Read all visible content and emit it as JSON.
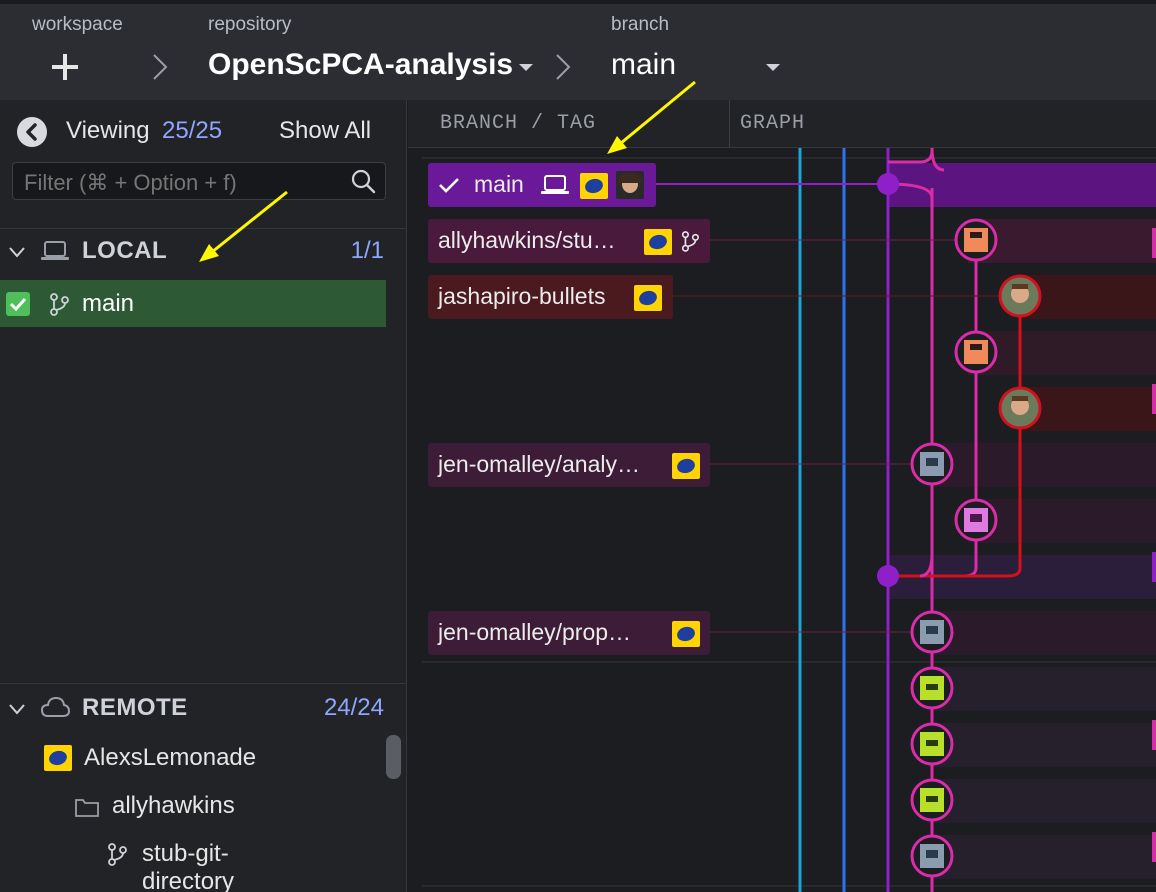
{
  "topbar": {
    "workspace_label": "workspace",
    "repository_label": "repository",
    "repository_name": "OpenScPCA-analysis",
    "branch_label": "branch",
    "branch_name": "main"
  },
  "sidebar": {
    "viewing_label": "Viewing",
    "viewing_count": "25/25",
    "show_all_label": "Show All",
    "filter_placeholder": "Filter (⌘ + Option + f)",
    "local": {
      "title": "LOCAL",
      "count": "1/1",
      "branches": [
        "main"
      ]
    },
    "remote": {
      "title": "REMOTE",
      "count": "24/24",
      "items": [
        {
          "label": "AlexsLemonade",
          "kind": "remote"
        },
        {
          "label": "allyhawkins",
          "kind": "folder"
        },
        {
          "label": "stub-git-directory",
          "kind": "branch"
        }
      ]
    }
  },
  "main": {
    "column_branch_tag": "BRANCH / TAG",
    "column_graph": "GRAPH",
    "refs": [
      {
        "label": "main",
        "checked": true,
        "row": 0
      },
      {
        "label": "allyhawkins/stu…",
        "row": 1
      },
      {
        "label": "jashapiro-bullets",
        "row": 2
      },
      {
        "label": "jen-omalley/analy…",
        "row": 5
      },
      {
        "label": "jen-omalley/prop…",
        "row": 8
      }
    ]
  },
  "colors": {
    "accent": "#8fa6ff",
    "local_highlight": "#2d5a35",
    "main_lane": "#8e1fc9",
    "pink_lane": "#d92ca8",
    "red_lane": "#d4101f",
    "cyan_lane": "#1fa3d6",
    "blue_lane": "#2f72f0",
    "annotation_arrow": "#fff700"
  }
}
